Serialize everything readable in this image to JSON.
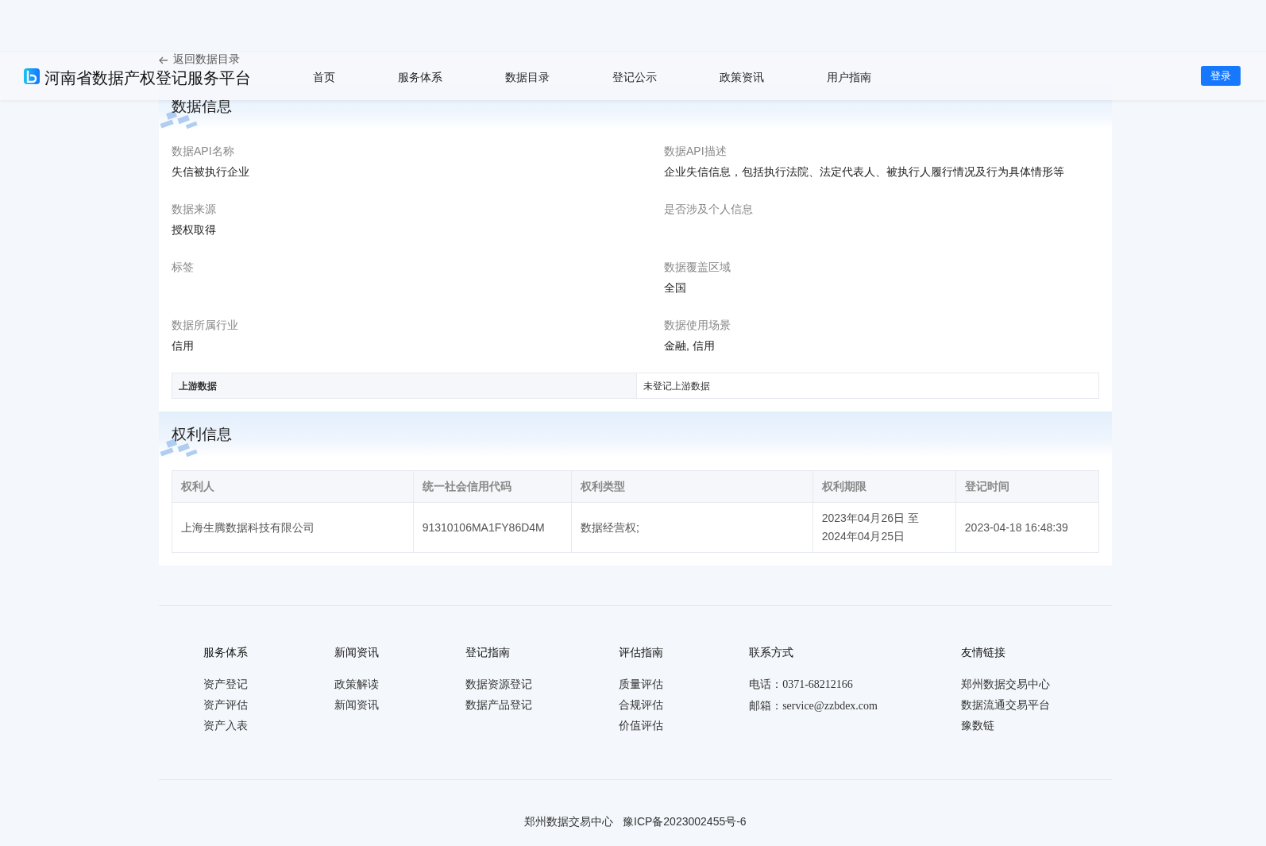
{
  "header": {
    "logo_text": "河南省数据产权登记服务平台",
    "nav": [
      {
        "label": "首页",
        "selected": false
      },
      {
        "label": "服务体系",
        "selected": false
      },
      {
        "label": "数据目录",
        "selected": false
      },
      {
        "label": "登记公示",
        "selected": false
      },
      {
        "label": "政策资讯",
        "selected": false
      },
      {
        "label": "用户指南",
        "selected": false
      }
    ],
    "login": "登录"
  },
  "back_link": "返回数据目录",
  "data_info": {
    "title": "数据信息",
    "fields": [
      {
        "label": "数据API名称",
        "value": "失信被执行企业"
      },
      {
        "label": "数据API描述",
        "value": "企业失信信息，包括执行法院、法定代表人、被执行人履行情况及行为具体情形等"
      },
      {
        "label": "数据来源",
        "value": "授权取得"
      },
      {
        "label": "是否涉及个人信息"
      },
      {
        "label": "标签"
      },
      {
        "label": "数据覆盖区域",
        "value": "全国"
      },
      {
        "label": "数据所属行业",
        "value": "信用"
      },
      {
        "label": "数据使用场景",
        "value": "金融, 信用"
      }
    ],
    "upstream": {
      "label": "上游数据",
      "value": "未登记上游数据"
    }
  },
  "rights_info": {
    "title": "权利信息",
    "columns": [
      "权利人",
      "统一社会信用代码",
      "权利类型",
      "权利期限",
      "登记时间"
    ],
    "rows": [
      [
        "上海生腾数据科技有限公司",
        "91310106MA1FY86D4M",
        "数据经营权;",
        "2023年04月26日 至 2024年04月25日",
        "2023-04-18 16:48:39"
      ]
    ]
  },
  "footer": {
    "columns": [
      {
        "title": "服务体系",
        "links": [
          "资产登记",
          "资产评估",
          "资产入表"
        ]
      },
      {
        "title": "新闻资讯",
        "links": [
          "政策解读",
          "新闻资讯"
        ]
      },
      {
        "title": "登记指南",
        "links": [
          "数据资源登记",
          "数据产品登记"
        ]
      },
      {
        "title": "评估指南",
        "links": [
          "质量评估",
          "合规评估",
          "价值评估"
        ]
      },
      {
        "title": "联系方式",
        "contacts": [
          {
            "label": "电话：",
            "value": "0371-68212166"
          },
          {
            "label": "邮箱：",
            "value": "service@zzbdex.com"
          }
        ]
      },
      {
        "title": "友情链接",
        "links": [
          "郑州数据交易中心",
          "数据流通交易平台",
          "豫数链"
        ]
      }
    ],
    "org": "郑州数据交易中心",
    "icp": "豫ICP备2023002455号-6"
  }
}
